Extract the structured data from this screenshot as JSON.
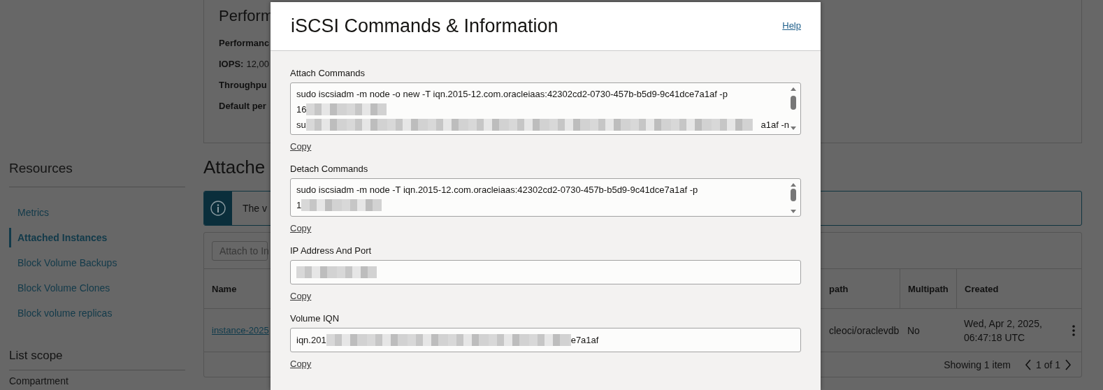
{
  "sidebar": {
    "title": "Resources",
    "items": [
      {
        "label": "Metrics",
        "selected": false
      },
      {
        "label": "Attached Instances",
        "selected": true
      },
      {
        "label": "Block Volume Backups",
        "selected": false
      },
      {
        "label": "Block Volume Clones",
        "selected": false
      },
      {
        "label": "Block volume replicas",
        "selected": false
      }
    ],
    "scope_title": "List scope",
    "scope_label": "Compartment"
  },
  "performance_card": {
    "title": "Perform",
    "rows": [
      {
        "label": "Performanc"
      },
      {
        "label": "IOPS:",
        "value": "12,00"
      },
      {
        "label": "Throughpu"
      },
      {
        "label": "Default per"
      }
    ]
  },
  "section_title": "Attache",
  "banner": {
    "text": "The v"
  },
  "table": {
    "button": "Attach to In",
    "columns": [
      "Name",
      "path",
      "Multipath",
      "Created"
    ],
    "rows": [
      {
        "cells": [
          "instance-2025",
          "cleoci/oraclevdb",
          "No",
          "Wed, Apr 2, 2025, 06:47:18 UTC"
        ]
      }
    ],
    "footer": {
      "count": "Showing 1 item",
      "page": "1 of 1"
    }
  },
  "dialog": {
    "title": "iSCSI Commands & Information",
    "help": "Help",
    "fields": [
      {
        "label": "Attach Commands",
        "kind": "multiline",
        "copy": "Copy",
        "lines": [
          [
            {
              "kind": "text",
              "text": "sudo iscsiadm -m node -o new -T iqn.2015-12.com.oracleiaas:42302cd2-0730-457b-b5d9-9c41dce7a1af -p"
            }
          ],
          [
            {
              "kind": "text",
              "text": "16"
            },
            {
              "kind": "redacted"
            }
          ],
          [
            {
              "kind": "text",
              "text": "su"
            },
            {
              "kind": "redacted"
            },
            {
              "kind": "text",
              "text": "a1af -n"
            }
          ]
        ]
      },
      {
        "label": "Detach Commands",
        "kind": "multiline",
        "copy": "Copy",
        "lines": [
          [
            {
              "kind": "text",
              "text": "sudo iscsiadm -m node -T iqn.2015-12.com.oracleiaas:42302cd2-0730-457b-b5d9-9c41dce7a1af -p"
            }
          ],
          [
            {
              "kind": "text",
              "text": "1"
            },
            {
              "kind": "redacted"
            }
          ]
        ]
      },
      {
        "label": "IP Address And Port",
        "kind": "single",
        "copy": "Copy",
        "lines": [
          [
            {
              "kind": "redacted"
            }
          ]
        ]
      },
      {
        "label": "Volume IQN",
        "kind": "single",
        "copy": "Copy",
        "lines": [
          [
            {
              "kind": "text",
              "text": "iqn.201"
            },
            {
              "kind": "redacted"
            },
            {
              "kind": "text",
              "text": "e7a1af"
            }
          ]
        ]
      }
    ]
  }
}
